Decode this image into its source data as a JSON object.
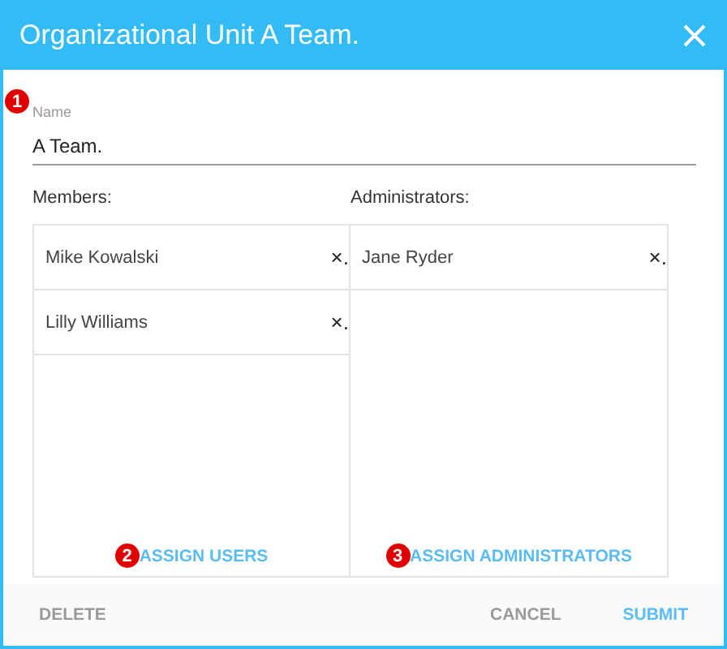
{
  "window": {
    "title": "Organizational Unit A Team."
  },
  "name_field": {
    "marker": "1",
    "label": "Name",
    "value": "A Team."
  },
  "panels": [
    {
      "heading": "Members:",
      "items": [
        {
          "name": "Mike Kowalski",
          "remove": "×."
        },
        {
          "name": "Lilly Williams",
          "remove": "×."
        }
      ],
      "marker": "2",
      "action": "ASSIGN USERS"
    },
    {
      "heading": "Administrators:",
      "items": [
        {
          "name": "Jane Ryder",
          "remove": "×."
        }
      ],
      "marker": "3",
      "action": "ASSIGN ADMINISTRATORS"
    }
  ],
  "footer": {
    "left": "DELETE",
    "buttons": [
      {
        "label": "CANCEL",
        "kind": "secondary"
      },
      {
        "label": "SUBMIT",
        "kind": "primary"
      }
    ]
  }
}
